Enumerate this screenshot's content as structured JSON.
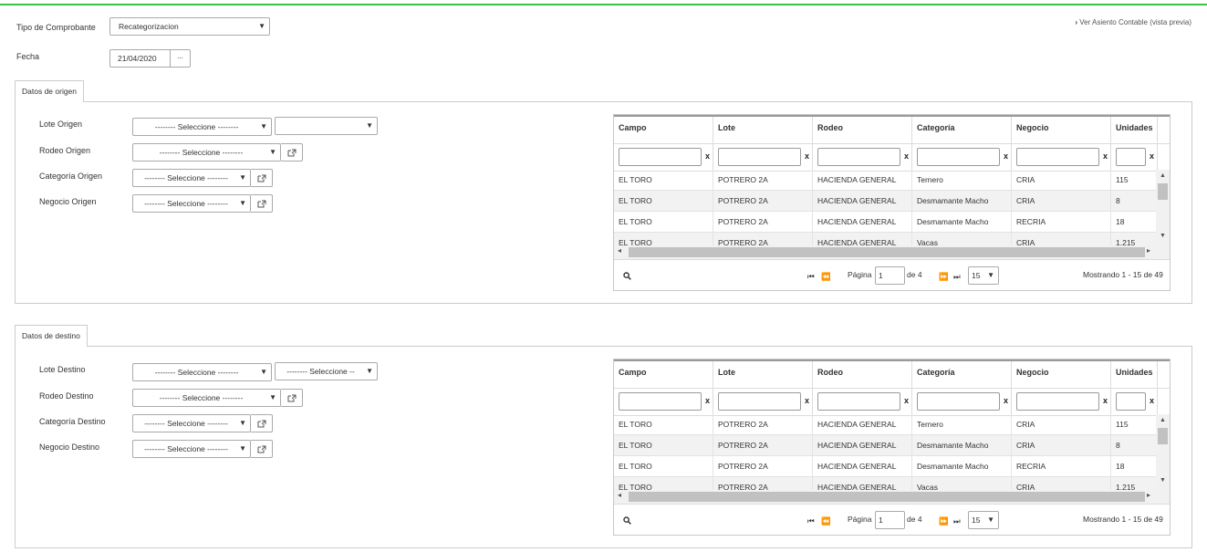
{
  "top_link": "Ver Asiento Contable (vista previa)",
  "tipo": {
    "label": "Tipo de Comprobante",
    "value": "Recategorizacion"
  },
  "fecha": {
    "label": "Fecha",
    "value": "21/04/2020",
    "button": "..."
  },
  "origen": {
    "tab": "Datos de origen",
    "lote": {
      "label": "Lote Origen",
      "value": "-------- Seleccione --------",
      "value2": ""
    },
    "rodeo": {
      "label": "Rodeo Origen",
      "value": "-------- Seleccione --------"
    },
    "categoria": {
      "label": "Categoría Origen",
      "value": "-------- Seleccione --------"
    },
    "negocio": {
      "label": "Negocio Origen",
      "value": "-------- Seleccione --------"
    }
  },
  "destino": {
    "tab": "Datos de destino",
    "lote": {
      "label": "Lote Destino",
      "value": "-------- Seleccione --------",
      "value2": "-------- Seleccione --"
    },
    "rodeo": {
      "label": "Rodeo Destino",
      "value": "-------- Seleccione --------"
    },
    "categoria": {
      "label": "Categoría Destino",
      "value": "-------- Seleccione --------"
    },
    "negocio": {
      "label": "Negocio Destino",
      "value": "-------- Seleccione --------"
    }
  },
  "grid": {
    "columns": [
      "Campo",
      "Lote",
      "Rodeo",
      "Categoría",
      "Negocio",
      "Unidades"
    ],
    "clear": "x",
    "rows": [
      [
        "EL TORO",
        "POTRERO 2A",
        "HACIENDA GENERAL",
        "Ternero",
        "CRIA",
        "115"
      ],
      [
        "EL TORO",
        "POTRERO 2A",
        "HACIENDA GENERAL",
        "Desmamante Macho",
        "CRIA",
        "8"
      ],
      [
        "EL TORO",
        "POTRERO 2A",
        "HACIENDA GENERAL",
        "Desmamante Macho",
        "RECRIA",
        "18"
      ],
      [
        "EL TORO",
        "POTRERO 2A",
        "HACIENDA GENERAL",
        "Vacas",
        "CRIA",
        "1.215"
      ]
    ],
    "pager": {
      "page_label": "Página",
      "page": "1",
      "of": "de 4",
      "size": "15",
      "showing": "Mostrando 1 - 15 de 49"
    }
  }
}
